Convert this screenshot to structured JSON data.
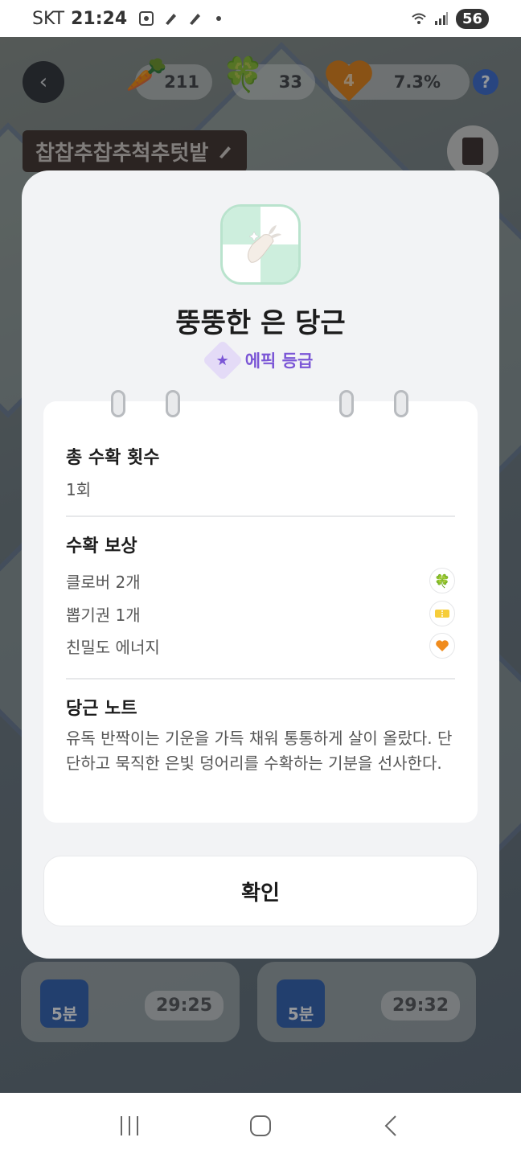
{
  "status_bar": {
    "carrier": "SKT",
    "time": "21:24",
    "battery": "56"
  },
  "hud": {
    "carrot_count": "211",
    "clover_count": "33",
    "heart_level": "4",
    "progress_percent": "7.3%",
    "help_label": "?"
  },
  "farm": {
    "name": "찹찹추찹추척추텃밭"
  },
  "background_timers": [
    {
      "badge": "5분",
      "time": "29:25"
    },
    {
      "badge": "5분",
      "time": "29:32"
    }
  ],
  "modal": {
    "item_name": "뚱뚱한 은 당근",
    "grade_label": "에픽 등급",
    "total_harvest_title": "총 수확 횟수",
    "total_harvest_value": "1회",
    "rewards_title": "수확 보상",
    "rewards": [
      {
        "label": "클로버 2개",
        "icon": "clover-icon"
      },
      {
        "label": "뽑기권 1개",
        "icon": "ticket-icon"
      },
      {
        "label": "친밀도 에너지",
        "icon": "heart-icon"
      }
    ],
    "note_title": "당근 노트",
    "note_text": "유독 반짝이는 기운을 가득 채워 통통하게 살이 올랐다. 단단하고 묵직한 은빛 덩어리를 수확하는 기분을 선사한다.",
    "confirm_label": "확인"
  },
  "colors": {
    "accent_purple": "#7b56d6",
    "grade_bg": "#e4dbf7",
    "icon_border_green": "#b9e3cd"
  }
}
